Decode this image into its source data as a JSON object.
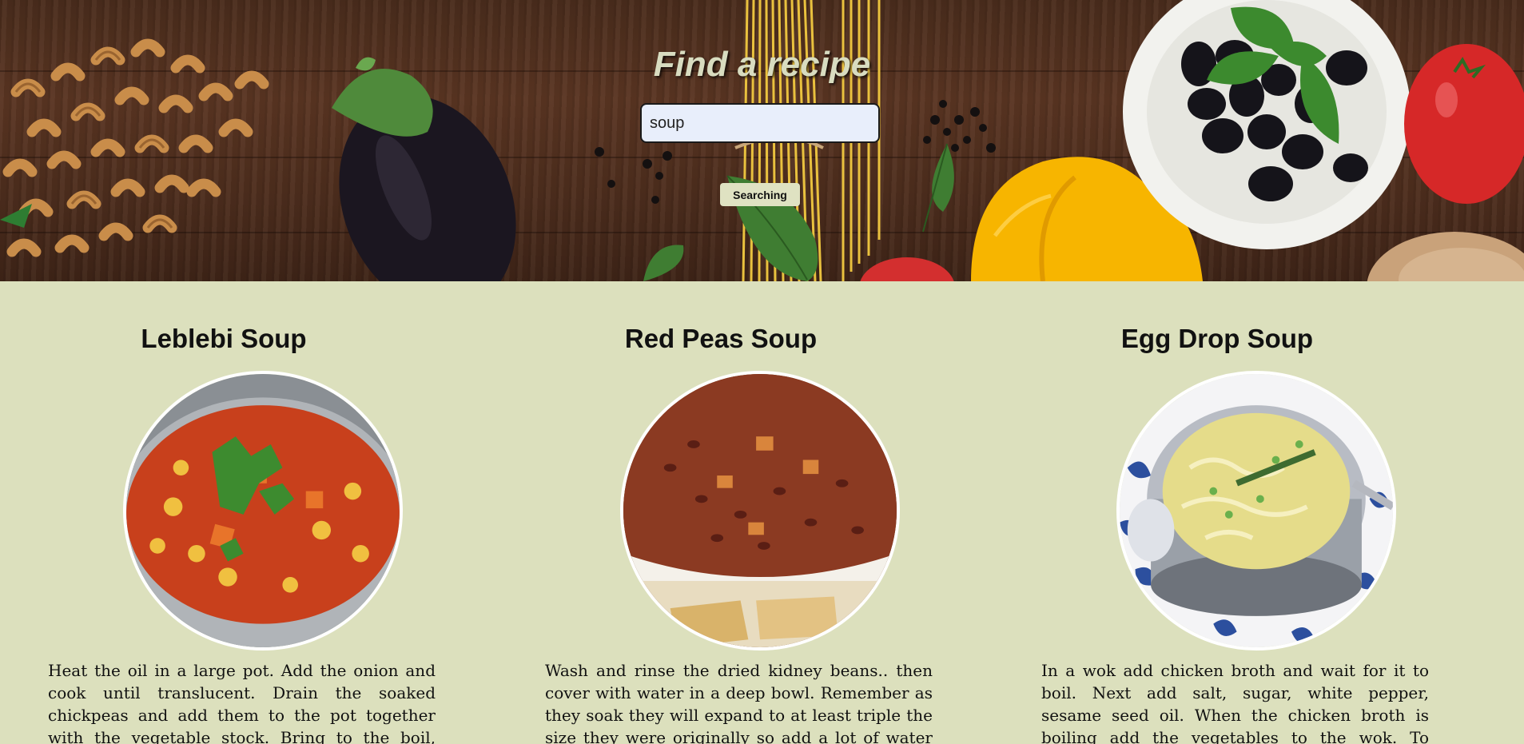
{
  "hero": {
    "title": "Find a recipe",
    "search_value": "soup",
    "search_button_label": "Searching"
  },
  "recipes": [
    {
      "title": "Leblebi Soup",
      "description": "Heat the oil in a large pot. Add the onion and cook until translucent. Drain the soaked chickpeas and add them to the pot together with the vegetable stock. Bring to the boil, then reduce the heat and"
    },
    {
      "title": "Red Peas Soup",
      "description": "Wash and rinse the dried kidney beans.. then cover with water in a deep bowl. Remember as they soak they will expand to at least triple the size they were originally so add a lot of water to the bowl. Soak"
    },
    {
      "title": "Egg Drop Soup",
      "description": "In a wok add chicken broth and wait for it to boil. Next add salt, sugar, white pepper, sesame seed oil. When the chicken broth is boiling add the vegetables to the wok. To thicken the sauce, whisk"
    }
  ],
  "colors": {
    "page_background": "#dce0bd",
    "hero_wood": "#4a2c1c",
    "title_text": "#d8dcc0",
    "search_bg": "#e8eefb",
    "button_bg": "#dfe2c2"
  }
}
